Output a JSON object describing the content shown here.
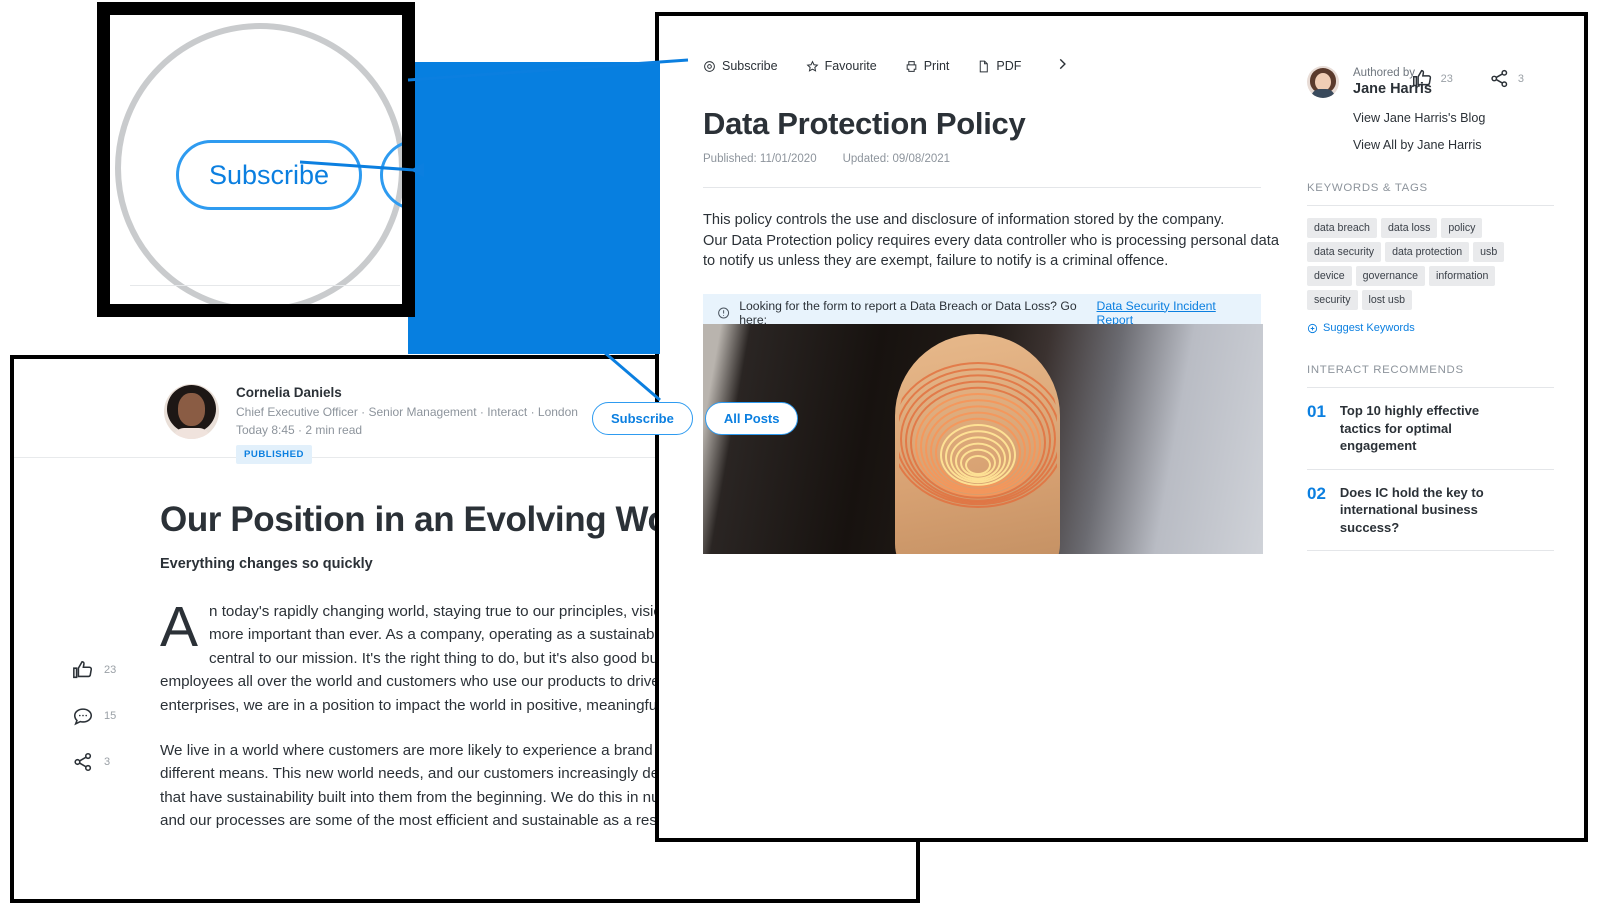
{
  "policy": {
    "toolbar": [
      {
        "label": "Subscribe",
        "icon": "eye-target-icon"
      },
      {
        "label": "Favourite",
        "icon": "star-icon"
      },
      {
        "label": "Print",
        "icon": "printer-icon"
      },
      {
        "label": "PDF",
        "icon": "document-icon"
      }
    ],
    "more_label": "›",
    "title": "Data Protection Policy",
    "published": "Published: 11/01/2020",
    "updated": "Updated: 09/08/2021",
    "body_lines": [
      "This policy controls the use and disclosure of information stored by the company.",
      "Our Data Protection policy requires every data controller who is processing personal data",
      "to notify us unless they are exempt, failure to notify is a criminal offence."
    ],
    "notice": {
      "text": "Looking for the form to report a Data Breach or Data Loss? Go here:",
      "link": "Data Security Incident Report",
      "icon": "info-circle-icon"
    },
    "actions": {
      "like_count": "23",
      "share_count": "3"
    },
    "sidebar": {
      "authored_by": "Authored by",
      "author_name": "Jane Harris",
      "link_blog": "View Jane Harris's Blog",
      "link_all": "View All by Jane Harris",
      "keywords_heading": "KEYWORDS & TAGS",
      "tags": [
        "data breach",
        "data loss",
        "policy",
        "data security",
        "data protection",
        "usb",
        "device",
        "governance",
        "information",
        "security",
        "lost usb"
      ],
      "suggest_label": "Suggest Keywords",
      "recommends_heading": "INTERACT RECOMMENDS",
      "recommends": [
        {
          "num": "01",
          "title": "Top 10 highly effective tactics for optimal engagement"
        },
        {
          "num": "02",
          "title": "Does IC hold the key to international business success?"
        }
      ]
    }
  },
  "blog": {
    "author": {
      "name": "Cornelia Daniels",
      "role": "Chief Executive Officer · Senior Management · Interact · London",
      "time": "Today 8:45 · 2 min read",
      "status": "PUBLISHED"
    },
    "buttons": {
      "subscribe": "Subscribe",
      "all_posts": "All Posts"
    },
    "title": "Our Position in an Evolving World",
    "subtitle": "Everything changes so quickly",
    "dropcap": "A",
    "paragraph1": "n today's rapidly changing world, staying true to our principles, vision and values is more important than ever. As a company, operating as a sustainable business is central to our mission. It's the right thing to do, but it's also good business. With employees all over the world and customers who use our products to drive their enterprises, we are in a position to impact the world in positive, meaningful ways.",
    "paragraph2": "We live in a world where customers are more likely to experience a brand through many different means. This new world needs, and our customers increasingly demand, services that have sustainability built into them from the beginning. We do this in numerous ways and our processes are some of the most efficient and sustainable as a result.",
    "rail": [
      {
        "icon": "thumbs-up-icon",
        "count": "23"
      },
      {
        "icon": "comment-icon",
        "count": "15"
      },
      {
        "icon": "share-icon",
        "count": "3"
      }
    ]
  },
  "callout": {
    "magnified_label": "Subscribe"
  },
  "colors": {
    "accent": "#0b7fe0",
    "blue_block": "#077fe0",
    "text": "#2b3137",
    "muted": "#8d949c",
    "notice_bg": "#e8f3fc"
  }
}
